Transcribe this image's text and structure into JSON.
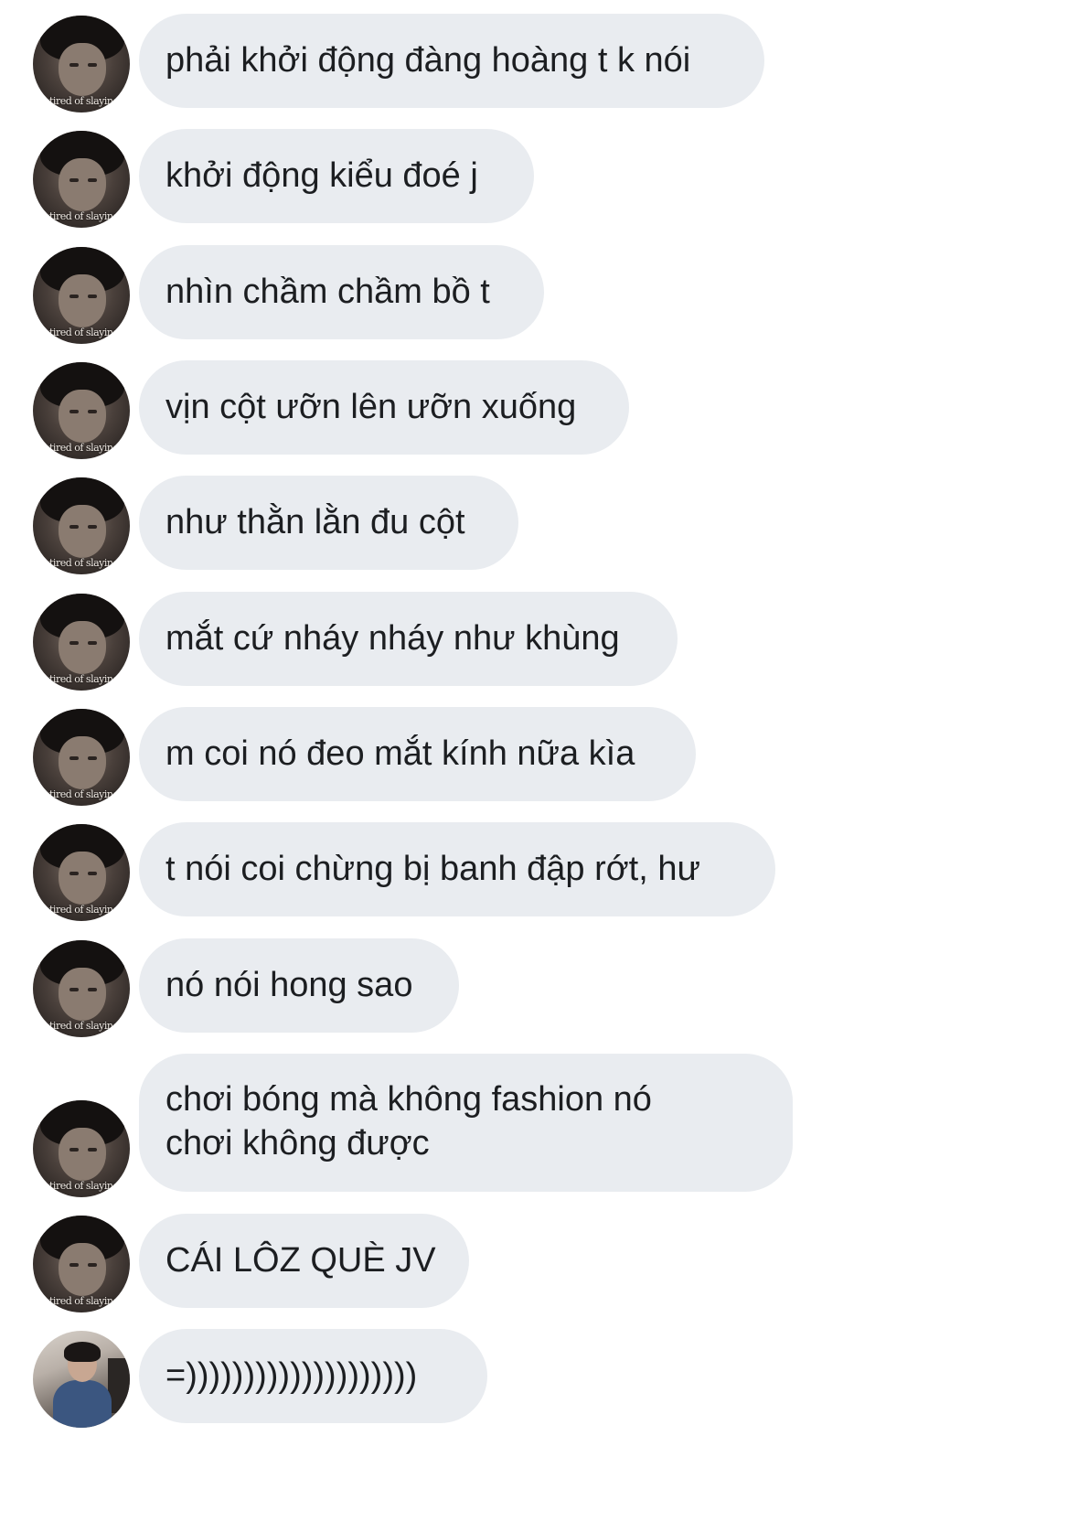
{
  "chat": {
    "messages": [
      {
        "text": "phải khởi động đàng hoàng t k nói",
        "avatar": "friend-avatar-icon",
        "avatar_caption": "tired of slaying"
      },
      {
        "text": "khởi động kiểu đoé j",
        "avatar": "friend-avatar-icon",
        "avatar_caption": "tired of slaying"
      },
      {
        "text": "nhìn chầm chầm bồ t",
        "avatar": "friend-avatar-icon",
        "avatar_caption": "tired of slaying"
      },
      {
        "text": "vịn cột ưỡn lên ưỡn xuống",
        "avatar": "friend-avatar-icon",
        "avatar_caption": "tired of slaying"
      },
      {
        "text": "như thằn lằn đu cột",
        "avatar": "friend-avatar-icon",
        "avatar_caption": "tired of slaying"
      },
      {
        "text": "mắt cứ nháy nháy như khùng",
        "avatar": "friend-avatar-icon",
        "avatar_caption": "tired of slaying"
      },
      {
        "text": "m coi nó đeo mắt kính nữa kìa",
        "avatar": "friend-avatar-icon",
        "avatar_caption": "tired of slaying"
      },
      {
        "text": "t nói coi chừng bị banh đập rớt, hư",
        "avatar": "friend-avatar-icon",
        "avatar_caption": "tired of slaying"
      },
      {
        "text": "nó nói hong sao",
        "avatar": "friend-avatar-icon",
        "avatar_caption": "tired of slaying"
      },
      {
        "lines": [
          "chơi bóng mà không fashion nó",
          "chơi không được"
        ],
        "avatar": "friend-avatar-icon",
        "avatar_caption": "tired of slaying"
      },
      {
        "text": "CÁI LÔZ QUÈ JV",
        "avatar": "friend-avatar-icon",
        "avatar_caption": "tired of slaying"
      },
      {
        "text": "=))))))))))))))))))))",
        "avatar": "second-friend-avatar-icon"
      }
    ]
  },
  "colors": {
    "bubble_background": "#e9ecf0",
    "text": "#1c1e21",
    "page_background": "#ffffff"
  }
}
